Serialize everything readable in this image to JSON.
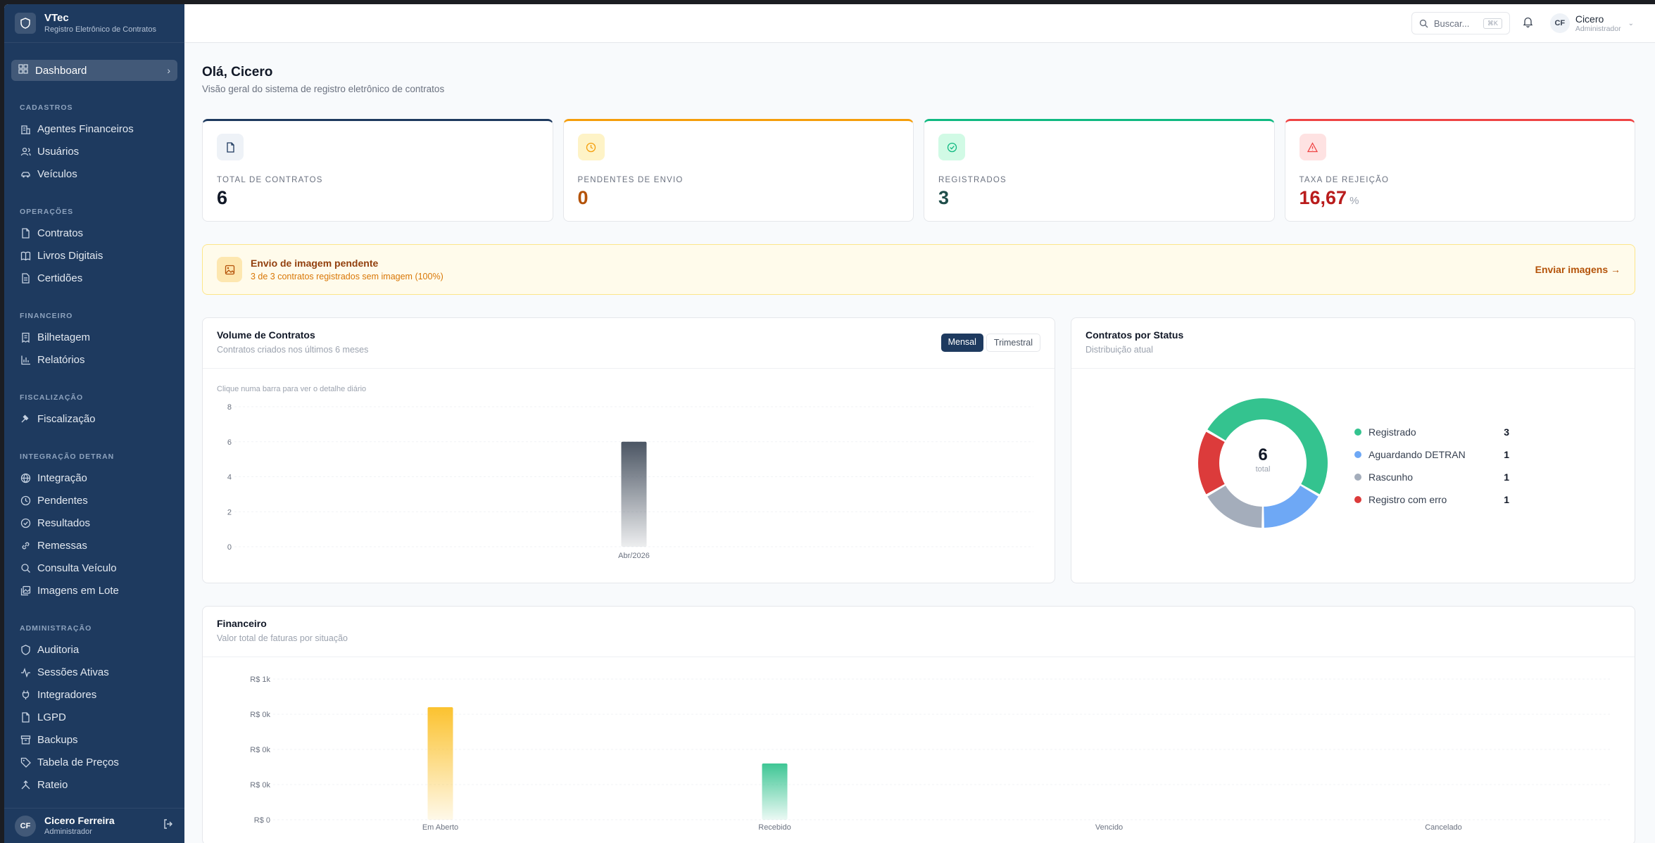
{
  "brand": {
    "name": "VTec",
    "subtitle": "Registro Eletrônico de Contratos"
  },
  "sidebar": {
    "active": {
      "label": "Dashboard"
    },
    "sections": [
      {
        "title": "CADASTROS",
        "items": [
          {
            "label": "Agentes Financeiros",
            "icon": "building-icon"
          },
          {
            "label": "Usuários",
            "icon": "users-icon"
          },
          {
            "label": "Veículos",
            "icon": "car-icon"
          }
        ]
      },
      {
        "title": "OPERAÇÕES",
        "items": [
          {
            "label": "Contratos",
            "icon": "file-icon"
          },
          {
            "label": "Livros Digitais",
            "icon": "book-icon"
          },
          {
            "label": "Certidões",
            "icon": "file-text-icon"
          }
        ]
      },
      {
        "title": "FINANCEIRO",
        "items": [
          {
            "label": "Bilhetagem",
            "icon": "receipt-icon"
          },
          {
            "label": "Relatórios",
            "icon": "bar-chart-icon"
          }
        ]
      },
      {
        "title": "FISCALIZAÇÃO",
        "items": [
          {
            "label": "Fiscalização",
            "icon": "gavel-icon"
          }
        ]
      },
      {
        "title": "INTEGRAÇÃO DETRAN",
        "items": [
          {
            "label": "Integração",
            "icon": "globe-icon"
          },
          {
            "label": "Pendentes",
            "icon": "clock-icon"
          },
          {
            "label": "Resultados",
            "icon": "check-circle-icon"
          },
          {
            "label": "Remessas",
            "icon": "link-icon"
          },
          {
            "label": "Consulta Veículo",
            "icon": "search-icon"
          },
          {
            "label": "Imagens em Lote",
            "icon": "images-icon"
          }
        ]
      },
      {
        "title": "ADMINISTRAÇÃO",
        "items": [
          {
            "label": "Auditoria",
            "icon": "shield-icon"
          },
          {
            "label": "Sessões Ativas",
            "icon": "activity-icon"
          },
          {
            "label": "Integradores",
            "icon": "plug-icon"
          },
          {
            "label": "LGPD",
            "icon": "file-icon"
          },
          {
            "label": "Backups",
            "icon": "archive-icon"
          },
          {
            "label": "Tabela de Preços",
            "icon": "tag-icon"
          },
          {
            "label": "Rateio",
            "icon": "split-icon"
          }
        ]
      }
    ],
    "user": {
      "initials": "CF",
      "name": "Cicero Ferreira",
      "role": "Administrador"
    }
  },
  "topbar": {
    "search_placeholder": "Buscar...",
    "shortcut": "⌘K",
    "user": {
      "initials": "CF",
      "name": "Cicero",
      "role": "Administrador"
    }
  },
  "page": {
    "greeting": "Olá, Cicero",
    "subtitle": "Visão geral do sistema de registro eletrônico de contratos"
  },
  "stats": [
    {
      "label": "TOTAL DE CONTRATOS",
      "value": "6",
      "unit": "",
      "accent": "#1e3a5f",
      "icon_bg": "#eef2f7",
      "value_color": "#111827",
      "icon": "file-icon"
    },
    {
      "label": "PENDENTES DE ENVIO",
      "value": "0",
      "unit": "",
      "accent": "#f59e0b",
      "icon_bg": "#fef3c7",
      "value_color": "#b45309",
      "icon": "clock-icon"
    },
    {
      "label": "REGISTRADOS",
      "value": "3",
      "unit": "",
      "accent": "#10b981",
      "icon_bg": "#d1fae5",
      "value_color": "#1f4e4a",
      "icon": "check-circle-icon"
    },
    {
      "label": "TAXA DE REJEIÇÃO",
      "value": "16,67",
      "unit": "%",
      "accent": "#ef4444",
      "icon_bg": "#fee2e2",
      "value_color": "#b91c1c",
      "icon": "alert-triangle-icon"
    }
  ],
  "banner": {
    "title": "Envio de imagem pendente",
    "subtitle": "3 de 3 contratos registrados sem imagem (100%)",
    "action": "Enviar imagens →"
  },
  "volume": {
    "title": "Volume de Contratos",
    "subtitle": "Contratos criados nos últimos 6 meses",
    "toggle": [
      "Mensal",
      "Trimestral"
    ],
    "hint": "Clique numa barra para ver o detalhe diário"
  },
  "status_card": {
    "title": "Contratos por Status",
    "subtitle": "Distribuição atual",
    "total": "6",
    "total_label": "total"
  },
  "finance": {
    "title": "Financeiro",
    "subtitle": "Valor total de faturas por situação"
  },
  "chart_data": [
    {
      "type": "bar",
      "categories": [
        "Abr/2026"
      ],
      "values": [
        6
      ],
      "ylim": [
        0,
        8
      ],
      "yticks": [
        "0",
        "2",
        "4",
        "6",
        "8"
      ],
      "color": "#4b5563"
    },
    {
      "type": "pie",
      "labels": [
        "Registrado",
        "Aguardando DETRAN",
        "Rascunho",
        "Registro com erro"
      ],
      "values": [
        3,
        1,
        1,
        1
      ],
      "colors": [
        "#34c38f",
        "#6ea8f5",
        "#a4adbb",
        "#dc3b3b"
      ]
    },
    {
      "type": "bar",
      "categories": [
        "Em Aberto",
        "Recebido",
        "Vencido",
        "Cancelado"
      ],
      "values": [
        0.8,
        0.4,
        0,
        0
      ],
      "ylim": [
        0,
        1
      ],
      "yticks": [
        "R$ 0",
        "R$ 0k",
        "R$ 0k",
        "R$ 0k",
        "R$ 1k"
      ],
      "colors": [
        "#fbbf24",
        "#34c38f",
        "#9ca3af",
        "#9ca3af"
      ]
    }
  ]
}
